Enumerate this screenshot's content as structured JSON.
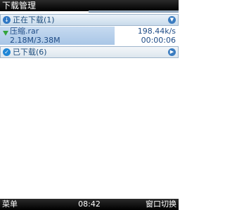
{
  "title": "下载管理",
  "sections": {
    "downloading": {
      "label": "正在下载(1)",
      "icon": "download-icon",
      "toggle_icon": "chevron-down-icon"
    },
    "downloaded": {
      "label": "已下载(6)",
      "icon": "check-icon",
      "toggle_icon": "chevron-right-icon"
    }
  },
  "download_item": {
    "name": "压缩.rar",
    "size": "2.18M/3.38M",
    "speed": "198.44k/s",
    "time": "00:00:06",
    "status_icon": "green-down-arrow-icon"
  },
  "softkeys": {
    "left": "菜单",
    "clock": "08:42",
    "right": "窗口切换"
  },
  "colors": {
    "bar": "#000000",
    "selection": "#b8cfe8",
    "accent": "#2f77c4",
    "status_green": "#33a43b"
  }
}
